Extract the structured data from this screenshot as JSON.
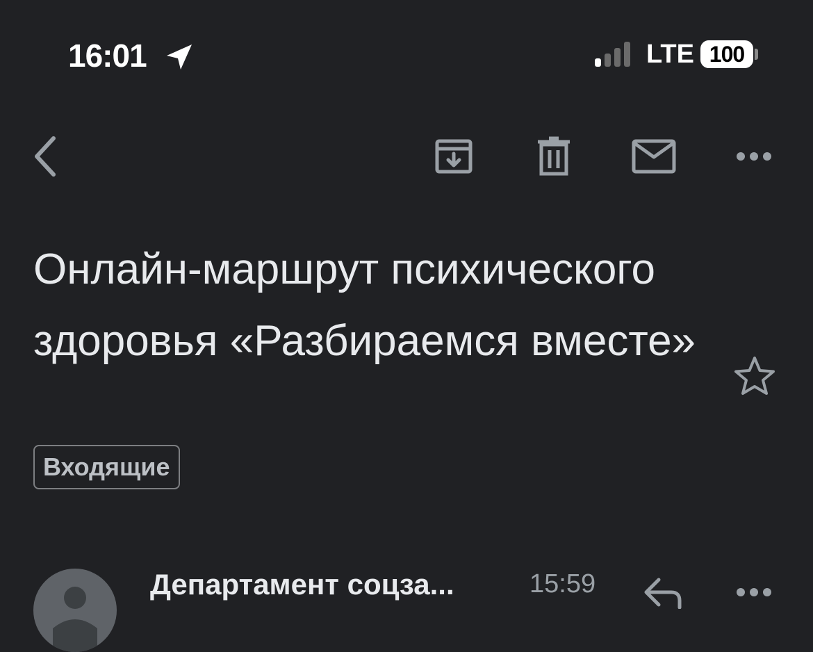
{
  "status_bar": {
    "time": "16:01",
    "network": "LTE",
    "battery": "100"
  },
  "toolbar": {
    "back_icon": "chevron-left-icon",
    "archive_icon": "archive-icon",
    "delete_icon": "trash-icon",
    "mark_unread_icon": "envelope-icon",
    "more_icon": "more-horizontal-icon"
  },
  "email": {
    "subject": "Онлайн-маршрут психического здоровья «Разбираемся вместе»",
    "label": "Входящие",
    "starred": false
  },
  "message": {
    "sender": "Департамент соцза...",
    "time": "15:59"
  },
  "colors": {
    "background": "#202124",
    "text": "#e8eaed",
    "icon": "#9aa0a6"
  }
}
